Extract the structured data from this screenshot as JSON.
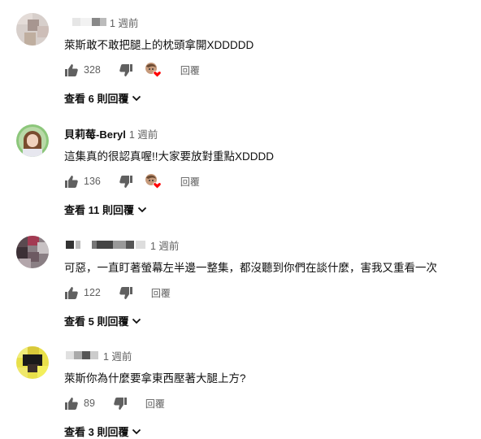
{
  "comments": [
    {
      "author": "",
      "time": "1 週前",
      "text": "萊斯敢不敢把腿上的枕頭拿開XDDDDD",
      "likes": "328",
      "creator_heart": true,
      "reply_label": "回覆",
      "view_replies": "查看 6 則回覆"
    },
    {
      "author": "貝莉莓-Beryl",
      "time": "1 週前",
      "text": "這集真的很認真喔!!大家要放對重點XDDDD",
      "likes": "136",
      "creator_heart": true,
      "reply_label": "回覆",
      "view_replies": "查看 11 則回覆"
    },
    {
      "author": "",
      "time": "1 週前",
      "text": "可惡，一直盯著螢幕左半邊一整集，都沒聽到你們在談什麼，害我又重看一次",
      "likes": "122",
      "creator_heart": false,
      "reply_label": "回覆",
      "view_replies": "查看 5 則回覆"
    },
    {
      "author": "",
      "time": "1 週前",
      "text": "萊斯你為什麼要拿東西壓著大腿上方?",
      "likes": "89",
      "creator_heart": false,
      "reply_label": "回覆",
      "view_replies": "查看 3 則回覆"
    }
  ]
}
